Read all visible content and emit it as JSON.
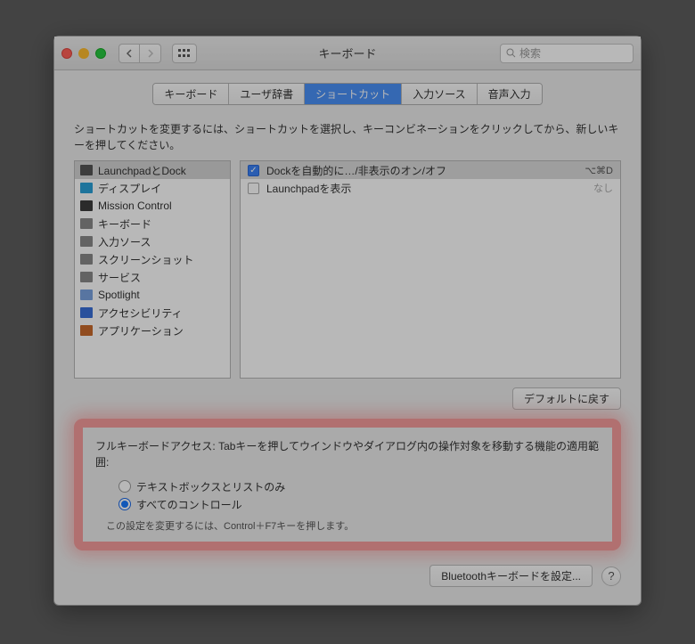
{
  "window": {
    "title": "キーボード",
    "search_placeholder": "検索"
  },
  "tabs": [
    {
      "label": "キーボード",
      "selected": false
    },
    {
      "label": "ユーザ辞書",
      "selected": false
    },
    {
      "label": "ショートカット",
      "selected": true
    },
    {
      "label": "入力ソース",
      "selected": false
    },
    {
      "label": "音声入力",
      "selected": false
    }
  ],
  "instructions": "ショートカットを変更するには、ショートカットを選択し、キーコンビネーションをクリックしてから、新しいキーを押してください。",
  "categories": [
    {
      "label": "LaunchpadとDock",
      "selected": true
    },
    {
      "label": "ディスプレイ"
    },
    {
      "label": "Mission Control"
    },
    {
      "label": "キーボード"
    },
    {
      "label": "入力ソース"
    },
    {
      "label": "スクリーンショット"
    },
    {
      "label": "サービス"
    },
    {
      "label": "Spotlight"
    },
    {
      "label": "アクセシビリティ"
    },
    {
      "label": "アプリケーション"
    }
  ],
  "shortcuts": [
    {
      "enabled": true,
      "label": "Dockを自動的に…/非表示のオン/オフ",
      "key": "⌥⌘D",
      "selected": true
    },
    {
      "enabled": false,
      "label": "Launchpadを表示",
      "key": "なし",
      "none": true
    }
  ],
  "defaults_button": "デフォルトに戻す",
  "fka": {
    "heading": "フルキーボードアクセス: Tabキーを押してウインドウやダイアログ内の操作対象を移動する機能の適用範囲:",
    "option_text_only": "テキストボックスとリストのみ",
    "option_all": "すべてのコントロール",
    "selected": "all",
    "hint": "この設定を変更するには、Control＋F7キーを押します。"
  },
  "bluetooth_button": "Bluetoothキーボードを設定...",
  "help_label": "?"
}
